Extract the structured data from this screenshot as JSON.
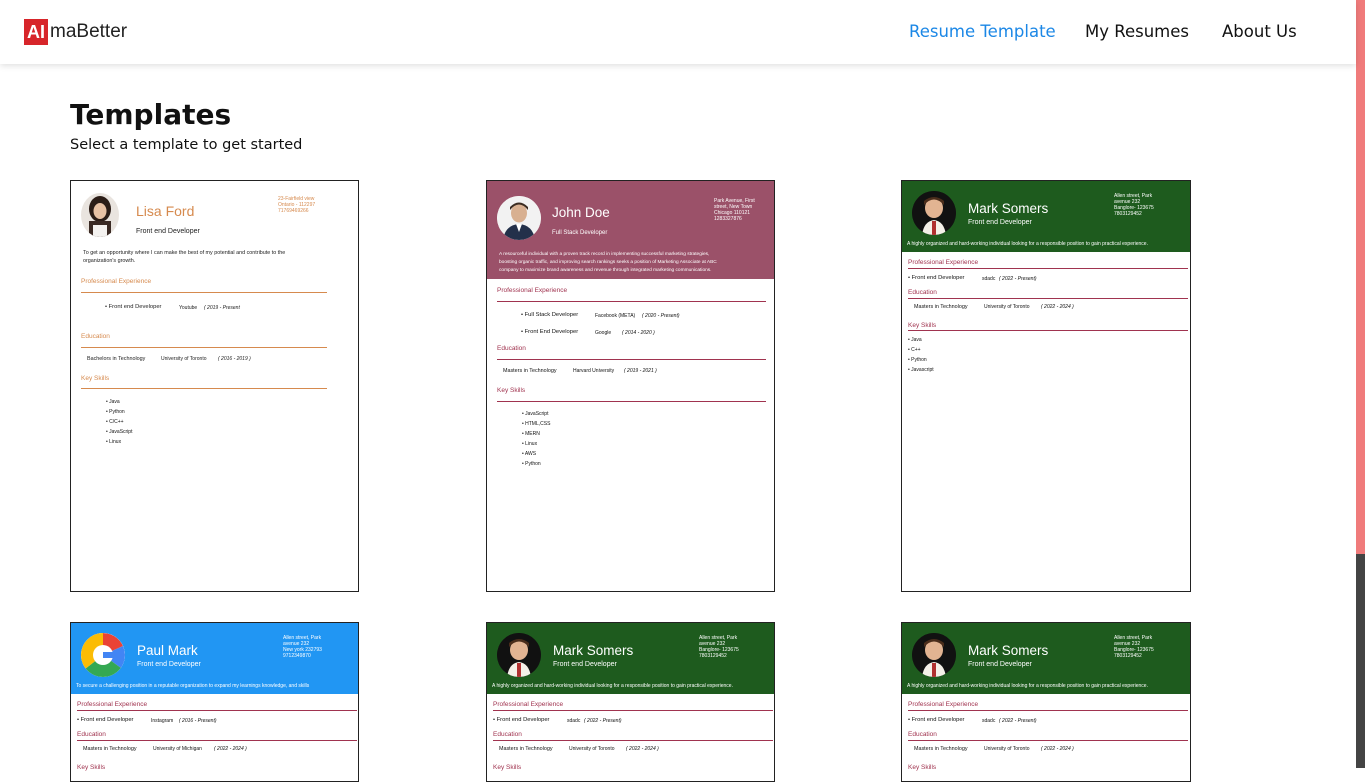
{
  "brand": {
    "ai": "AI",
    "rest": "maBetter"
  },
  "nav": {
    "resume_template": "Resume Template",
    "my_resumes": "My Resumes",
    "about_us": "About Us"
  },
  "page": {
    "title": "Templates",
    "subtitle": "Select a template to get started"
  },
  "colors": {
    "accent": "#1b87e6",
    "logo_red": "#d7252a",
    "lisa_orange": "#d68a4e",
    "john_header": "#9b5169",
    "green_header": "#1e5b1e",
    "blue_header": "#2196f3",
    "section_red": "#a0334f"
  },
  "templates": {
    "lisa": {
      "name": "Lisa Ford",
      "role": "Front end Developer",
      "address": [
        "23-Fairfield view",
        "Ontario - 112297",
        "71769469266"
      ],
      "objective": [
        "To get an opportunity  where I can make the best of my potential and contribute  to the",
        "organization's growth."
      ],
      "exp_title": "Professional Experience",
      "exp": [
        {
          "role": "• Front end Developer",
          "company": "Youtube",
          "dates": "( 2019 - Present"
        }
      ],
      "edu_title": "Education",
      "edu": {
        "degree": "Bachelors in Technology",
        "school": "University of Toronto",
        "dates": "( 2016 - 2019 )"
      },
      "skills_title": "Key Skills",
      "skills": [
        "• Java",
        "• Python",
        "• C/C++",
        "• JavaScript",
        "• Linux"
      ]
    },
    "john": {
      "name": "John Doe",
      "role": "Full Stack Developer",
      "address": [
        "Park Avenue, First",
        "street, New Town",
        "Chicago 110121",
        "1283327876"
      ],
      "objective": [
        "A resourceful individual with a proven track record in implementing successful marketing strategies,",
        "boosting organic traffic, and improving search rankings seeks a position of Marketing Associate at ABC",
        "company to maximize brand awareness and revenue through integrated marketing communications."
      ],
      "exp_title": "Professional Experience",
      "exp": [
        {
          "role": "• Full Stack Developer",
          "company": "Facebook (META)",
          "dates": "( 2020 - Present)"
        },
        {
          "role": "• Front End Developer",
          "company": "Google",
          "dates": "( 2014 - 2020 )"
        }
      ],
      "edu_title": "Education",
      "edu": {
        "degree": "Masters in Technology",
        "school": "Harvard University",
        "dates": "( 2019 - 2021 )"
      },
      "skills_title": "Key Skills",
      "skills": [
        "• JavaScript",
        "• HTML,CSS",
        "• MERN",
        "• Linux",
        "• AWS",
        "• Python"
      ]
    },
    "mark": {
      "name": "Mark Somers",
      "role": "Front end Developer",
      "address": [
        "Allen street, Park",
        "avenue 232",
        "Banglore- 123675",
        "7803129452"
      ],
      "objective": "A highly organized and hard-working individual looking for a responsible position to gain practical experience.",
      "exp_title": "Professional Experience",
      "exp": [
        {
          "role": "• Front end Developer",
          "company": "sdadc",
          "dates": "( 2022 - Present)"
        }
      ],
      "edu_title": "Education",
      "edu": {
        "degree": "Masters in Technology",
        "school": "University of Toronto",
        "dates": "( 2022 - 2024 )"
      },
      "skills_title": "Key Skills",
      "skills": [
        "• Java",
        "• C++",
        "• Python",
        "• Javascript"
      ]
    },
    "paul": {
      "name": "Paul Mark",
      "role": "Front end Developer",
      "address": [
        "Allen street, Park",
        "avenue 232",
        "New york  232793",
        "9712349870"
      ],
      "objective": "To secure a challenging position in a reputable organization to expand my learnings knowledge, and skills",
      "exp_title": "Professional Experience",
      "exp": [
        {
          "role": "• Front end Developer",
          "company": "Instagram",
          "dates": "( 2016 - Present)"
        }
      ],
      "edu_title": "Education",
      "edu": {
        "degree": "Masters in Technology",
        "school": "University of Michigan",
        "dates": "( 2022 - 2024 )"
      },
      "skills_title": "Key Skills"
    }
  }
}
